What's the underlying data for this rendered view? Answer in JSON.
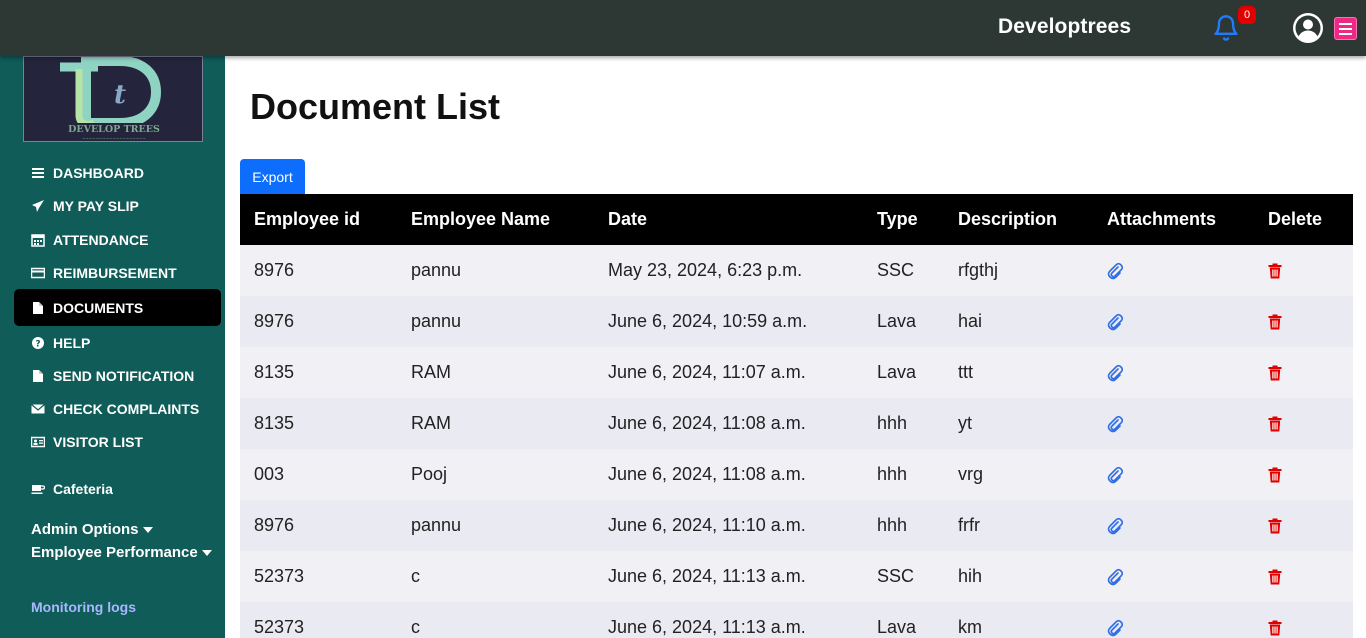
{
  "header": {
    "brand": "Developtrees",
    "notification_count": "0",
    "icons": [
      "bell-icon",
      "user-circle-icon",
      "hamburger-menu-icon"
    ]
  },
  "sidebar": {
    "logo_text": "DEVELOP TREES",
    "items": [
      {
        "label": "DASHBOARD",
        "icon": "bars-icon"
      },
      {
        "label": "MY PAY SLIP",
        "icon": "paper-plane-icon"
      },
      {
        "label": "ATTENDANCE",
        "icon": "calendar-icon"
      },
      {
        "label": "REIMBURSEMENT",
        "icon": "credit-card-icon"
      },
      {
        "label": "DOCUMENTS",
        "icon": "file-icon",
        "active": true
      },
      {
        "label": "HELP",
        "icon": "question-circle-icon"
      },
      {
        "label": "SEND NOTIFICATION",
        "icon": "file-icon"
      },
      {
        "label": "CHECK COMPLAINTS",
        "icon": "envelope-icon"
      },
      {
        "label": "VISITOR LIST",
        "icon": "id-card-icon"
      },
      {
        "label": "Cafeteria",
        "icon": "coffee-icon"
      }
    ],
    "dropdowns": [
      "Admin Options",
      "Employee Performance"
    ],
    "monitoring_logs": "Monitoring logs"
  },
  "main": {
    "title": "Document List",
    "export_label": "Export",
    "columns": [
      "Employee id",
      "Employee Name",
      "Date",
      "Type",
      "Description",
      "Attachments",
      "Delete"
    ],
    "rows": [
      {
        "id": "8976",
        "name": "pannu",
        "date": "May 23, 2024, 6:23 p.m.",
        "type": "SSC",
        "description": "rfgthj"
      },
      {
        "id": "8976",
        "name": "pannu",
        "date": "June 6, 2024, 10:59 a.m.",
        "type": "Lava",
        "description": "hai"
      },
      {
        "id": "8135",
        "name": "RAM",
        "date": "June 6, 2024, 11:07 a.m.",
        "type": "Lava",
        "description": "ttt"
      },
      {
        "id": "8135",
        "name": "RAM",
        "date": "June 6, 2024, 11:08 a.m.",
        "type": "hhh",
        "description": "yt"
      },
      {
        "id": "003",
        "name": "Pooj",
        "date": "June 6, 2024, 11:08 a.m.",
        "type": "hhh",
        "description": "vrg"
      },
      {
        "id": "8976",
        "name": "pannu",
        "date": "June 6, 2024, 11:10 a.m.",
        "type": "hhh",
        "description": "frfr"
      },
      {
        "id": "52373",
        "name": "c",
        "date": "June 6, 2024, 11:13 a.m.",
        "type": "SSC",
        "description": "hih"
      },
      {
        "id": "52373",
        "name": "c",
        "date": "June 6, 2024, 11:13 a.m.",
        "type": "Lava",
        "description": "km"
      }
    ]
  },
  "colors": {
    "topbar": "#2d3834",
    "sidebar": "#0f5c58",
    "accent": "#0d6efd",
    "delete": "#e00000",
    "badge": "#e00000",
    "menu_button": "#ec2a86"
  }
}
